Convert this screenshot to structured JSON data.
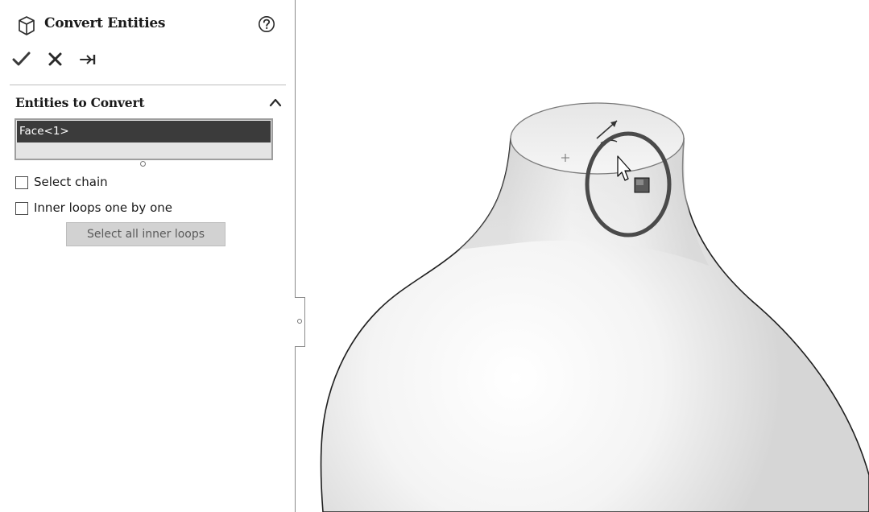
{
  "panel": {
    "title": "Convert Entities",
    "title_icon": "cube-icon",
    "help_icon": "help-circle-icon",
    "actions": [
      {
        "name": "ok",
        "icon": "checkmark-icon"
      },
      {
        "name": "cancel",
        "icon": "close-icon"
      },
      {
        "name": "pin",
        "icon": "pushpin-icon"
      }
    ]
  },
  "entities_group": {
    "title": "Entities to Convert",
    "collapse_icon": "chevron-up-icon",
    "selected_items": [
      "Face<1>"
    ],
    "options": [
      {
        "label": "Select chain",
        "checked": false
      },
      {
        "label": "Inner loops one by one",
        "checked": false
      }
    ],
    "select_inner_loops_label": "Select all inner loops"
  },
  "graphics": {
    "model": "vase-body",
    "highlight": "selection-circle",
    "cursor_icon": "select-pointer-icon",
    "triad_icon": "direction-arrow-icon"
  },
  "colors": {
    "selected_row_bg": "#3b3b3b",
    "listbox_bg": "#e4e4e4",
    "button_bg": "#d2d2d2",
    "circle_stroke": "#4a4a4a"
  }
}
